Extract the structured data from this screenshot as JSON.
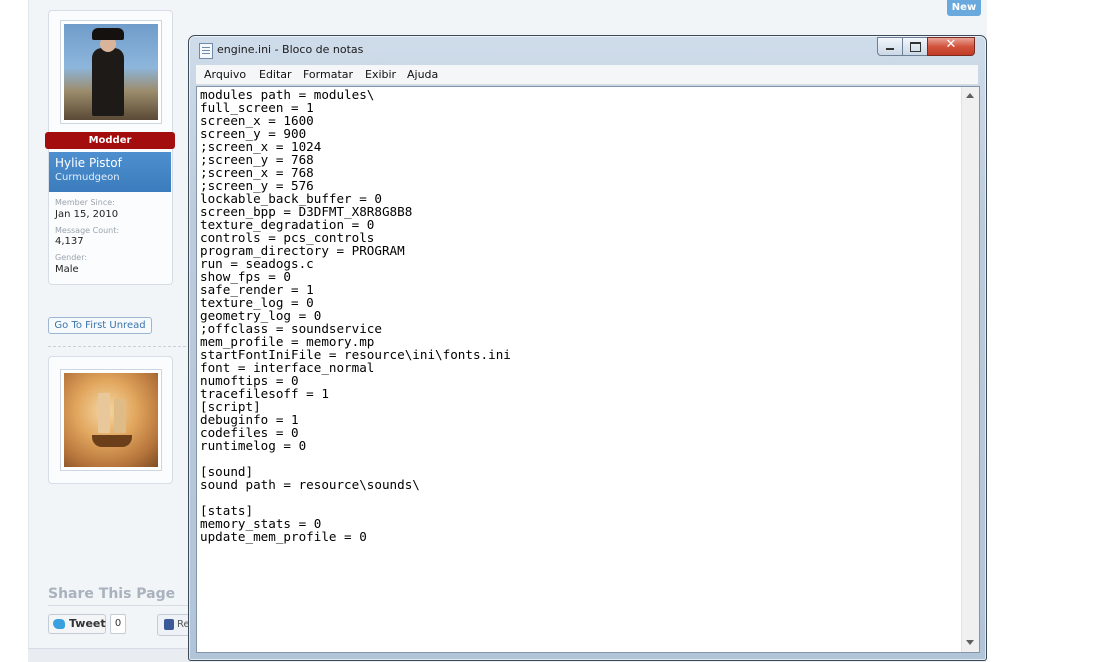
{
  "forum": {
    "new_label": "New",
    "user": {
      "role_badge": "Modder",
      "name": "Hylie Pistof",
      "title": "Curmudgeon",
      "member_since_label": "Member Since:",
      "member_since": "Jan 15, 2010",
      "message_count_label": "Message Count:",
      "message_count": "4,137",
      "gender_label": "Gender:",
      "gender": "Male"
    },
    "go_first_unread": "Go To First Unread",
    "share_title": "Share This Page",
    "tweet_label": "Tweet",
    "tweet_count": "0",
    "like_label": "Re"
  },
  "notepad": {
    "title": "engine.ini - Bloco de notas",
    "menu": [
      "Arquivo",
      "Editar",
      "Formatar",
      "Exibir",
      "Ajuda"
    ],
    "close_glyph": "✕",
    "content": "modules path = modules\\\nfull_screen = 1\nscreen_x = 1600\nscreen_y = 900\n;screen_x = 1024\n;screen_y = 768\n;screen_x = 768\n;screen_y = 576\nlockable_back_buffer = 0\nscreen_bpp = D3DFMT_X8R8G8B8\ntexture_degradation = 0\ncontrols = pcs_controls\nprogram_directory = PROGRAM\nrun = seadogs.c\nshow_fps = 0\nsafe_render = 1\ntexture_log = 0\ngeometry_log = 0\n;offclass = soundservice\nmem_profile = memory.mp\nstartFontIniFile = resource\\ini\\fonts.ini\nfont = interface_normal\nnumoftips = 0\ntracefilesoff = 1\n[script]\ndebuginfo = 1\ncodefiles = 0\nruntimelog = 0\n\n[sound]\nsound path = resource\\sounds\\\n\n[stats]\nmemory_stats = 0\nupdate_mem_profile = 0"
  }
}
